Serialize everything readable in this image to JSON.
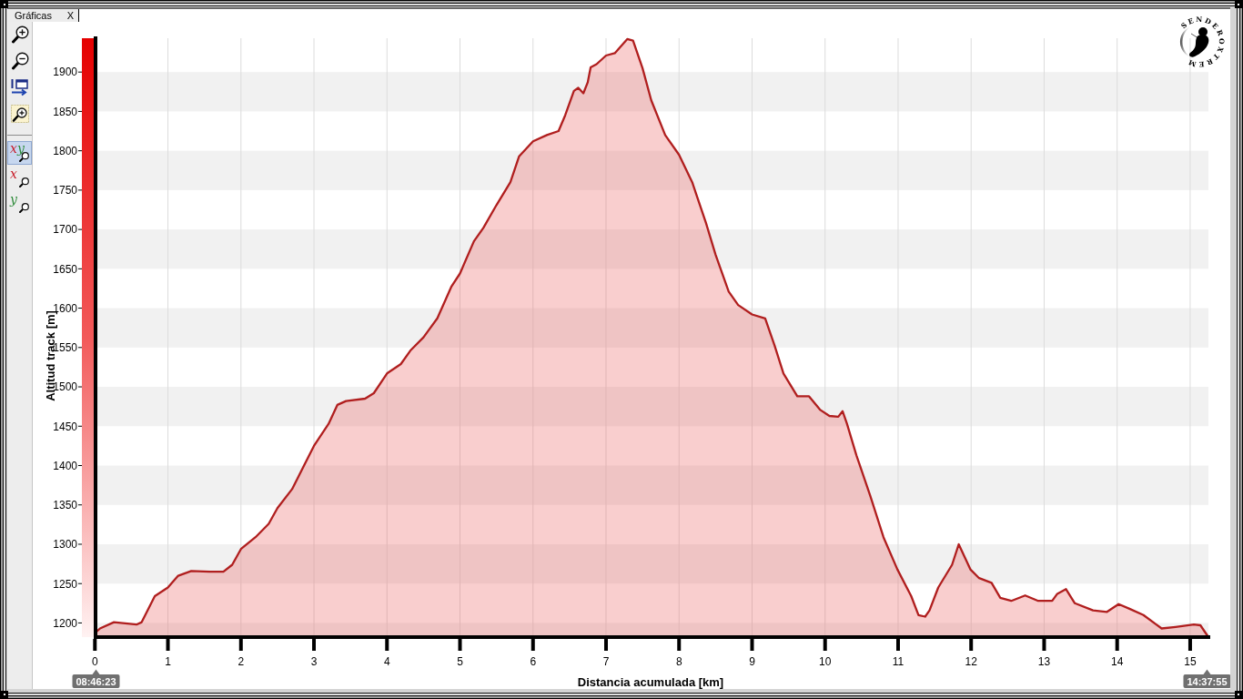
{
  "window": {
    "tab": {
      "label": "Gráficas",
      "close": "X",
      "selected": true
    }
  },
  "toolbar": {
    "tools": [
      {
        "kind": "zoom-in"
      },
      {
        "kind": "zoom-out"
      },
      {
        "kind": "window-move"
      },
      {
        "kind": "zoom-area"
      }
    ],
    "axis_modes": [
      {
        "letters": [
          {
            "text": "x",
            "color": "#c81e2a"
          },
          {
            "text": "y",
            "color": "#2e8b3a"
          }
        ],
        "selected": true
      },
      {
        "letters": [
          {
            "text": "x",
            "color": "#c81e2a"
          }
        ],
        "selected": false
      },
      {
        "letters": [
          {
            "text": "y",
            "color": "#2e8b3a"
          }
        ],
        "selected": false
      }
    ]
  },
  "logo": {
    "text": "SENDEROXTREM"
  },
  "chart": {
    "chart_data": {
      "type": "area",
      "xlabel": "Distancia acumulada [km]",
      "ylabel": "Altitud track [m]",
      "grid": true,
      "x": [
        0,
        0.07,
        0.26,
        0.57,
        0.64,
        0.82,
        1.0,
        1.14,
        1.32,
        1.57,
        1.76,
        1.88,
        2.0,
        2.2,
        2.38,
        2.5,
        2.7,
        3.0,
        3.2,
        3.32,
        3.44,
        3.7,
        3.82,
        4.0,
        4.19,
        4.32,
        4.5,
        4.57,
        4.69,
        4.88,
        5.0,
        5.19,
        5.32,
        5.5,
        5.69,
        5.81,
        6.0,
        6.19,
        6.35,
        6.44,
        6.56,
        6.62,
        6.69,
        6.75,
        6.79,
        6.87,
        7.0,
        7.12,
        7.29,
        7.37,
        7.5,
        7.62,
        7.81,
        8.0,
        8.18,
        8.37,
        8.5,
        8.68,
        8.81,
        9.0,
        9.18,
        9.31,
        9.43,
        9.62,
        9.78,
        9.93,
        10.06,
        10.18,
        10.24,
        10.3,
        10.43,
        10.62,
        10.8,
        10.99,
        11.18,
        11.28,
        11.37,
        11.43,
        11.55,
        11.74,
        11.83,
        11.99,
        12.11,
        12.28,
        12.4,
        12.55,
        12.74,
        12.92,
        13.11,
        13.18,
        13.3,
        13.42,
        13.67,
        13.86,
        14.02,
        14.17,
        14.36,
        14.61,
        14.8,
        15.05,
        15.14,
        15.25
      ],
      "series": [
        {
          "color": "#b01e1e",
          "values": [
            1187,
            1193,
            1201,
            1198,
            1201,
            1234,
            1245,
            1260,
            1266,
            1265,
            1265,
            1274,
            1294,
            1309,
            1326,
            1346,
            1370,
            1425,
            1453,
            1477,
            1482,
            1485,
            1492,
            1517,
            1529,
            1546,
            1563,
            1572,
            1587,
            1627,
            1644,
            1685,
            1702,
            1731,
            1760,
            1793,
            1812,
            1820,
            1825,
            1845,
            1876,
            1880,
            1873,
            1887,
            1906,
            1910,
            1921,
            1924,
            1942,
            1940,
            1905,
            1864,
            1820,
            1795,
            1760,
            1708,
            1668,
            1621,
            1604,
            1592,
            1587,
            1552,
            1517,
            1488,
            1488,
            1471,
            1463,
            1462,
            1469,
            1453,
            1413,
            1361,
            1309,
            1268,
            1234,
            1210,
            1208,
            1216,
            1245,
            1274,
            1300,
            1268,
            1257,
            1251,
            1232,
            1228,
            1235,
            1228,
            1228,
            1237,
            1243,
            1225,
            1216,
            1214,
            1224,
            1218,
            1210,
            1193,
            1195,
            1198,
            1197,
            1182
          ]
        }
      ],
      "xlim": [
        0,
        15.25
      ],
      "ylim": [
        1182,
        1943
      ],
      "xticks": [
        0,
        1,
        2,
        3,
        4,
        5,
        6,
        7,
        8,
        9,
        10,
        11,
        12,
        13,
        14,
        15
      ],
      "yticks": [
        1200,
        1250,
        1300,
        1350,
        1400,
        1450,
        1500,
        1550,
        1600,
        1650,
        1700,
        1750,
        1800,
        1850,
        1900
      ]
    },
    "time_badges": [
      "08:46:23",
      "14:37:55"
    ]
  }
}
